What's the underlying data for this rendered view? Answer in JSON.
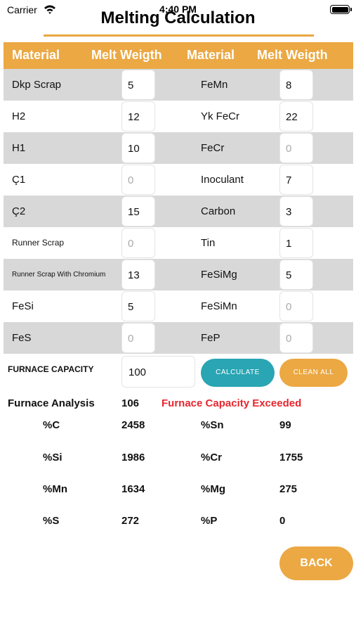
{
  "status_bar": {
    "carrier": "Carrier",
    "time": "4:40 PM"
  },
  "page": {
    "title": "Melting Calculation"
  },
  "table": {
    "headers": [
      "Material",
      "Melt Weigth",
      "Material",
      "Melt Weigth"
    ],
    "rows": [
      {
        "left": {
          "label": "Dkp Scrap",
          "value": "5"
        },
        "right": {
          "label": "FeMn",
          "value": "8"
        }
      },
      {
        "left": {
          "label": "H2",
          "value": "12"
        },
        "right": {
          "label": "Yk FeCr",
          "value": "22"
        }
      },
      {
        "left": {
          "label": "H1",
          "value": "10"
        },
        "right": {
          "label": "FeCr",
          "value": "0"
        }
      },
      {
        "left": {
          "label": "Ç1",
          "value": "0"
        },
        "right": {
          "label": "Inoculant",
          "value": "7"
        }
      },
      {
        "left": {
          "label": "Ç2",
          "value": "15"
        },
        "right": {
          "label": "Carbon",
          "value": "3"
        }
      },
      {
        "left": {
          "label": "Runner Scrap",
          "value": "0"
        },
        "right": {
          "label": "Tin",
          "value": "1"
        }
      },
      {
        "left": {
          "label": "Runner Scrap With Chromium",
          "value": "13"
        },
        "right": {
          "label": "FeSiMg",
          "value": "5"
        }
      },
      {
        "left": {
          "label": "FeSi",
          "value": "5"
        },
        "right": {
          "label": "FeSiMn",
          "value": "0"
        }
      },
      {
        "left": {
          "label": "FeS",
          "value": "0"
        },
        "right": {
          "label": "FeP",
          "value": "0"
        }
      }
    ]
  },
  "capacity": {
    "label": "FURNACE CAPACITY",
    "value": "100"
  },
  "buttons": {
    "calculate": "CALCULATE",
    "clean_all": "CLEAN ALL",
    "back": "BACK"
  },
  "analysis": {
    "label": "Furnace Analysis",
    "value": "106",
    "warning": "Furnace Capacity Exceeded",
    "items": [
      {
        "left_label": "%C",
        "left_value": "2458",
        "right_label": "%Sn",
        "right_value": "99"
      },
      {
        "left_label": "%Si",
        "left_value": "1986",
        "right_label": "%Cr",
        "right_value": "1755"
      },
      {
        "left_label": "%Mn",
        "left_value": "1634",
        "right_label": "%Mg",
        "right_value": "275"
      },
      {
        "left_label": "%S",
        "left_value": "272",
        "right_label": "%P",
        "right_value": "0"
      }
    ]
  },
  "colors": {
    "accent": "#eba843",
    "teal": "#29a5b3",
    "warning": "#e8262e",
    "row_shade": "#d8d8d8"
  }
}
